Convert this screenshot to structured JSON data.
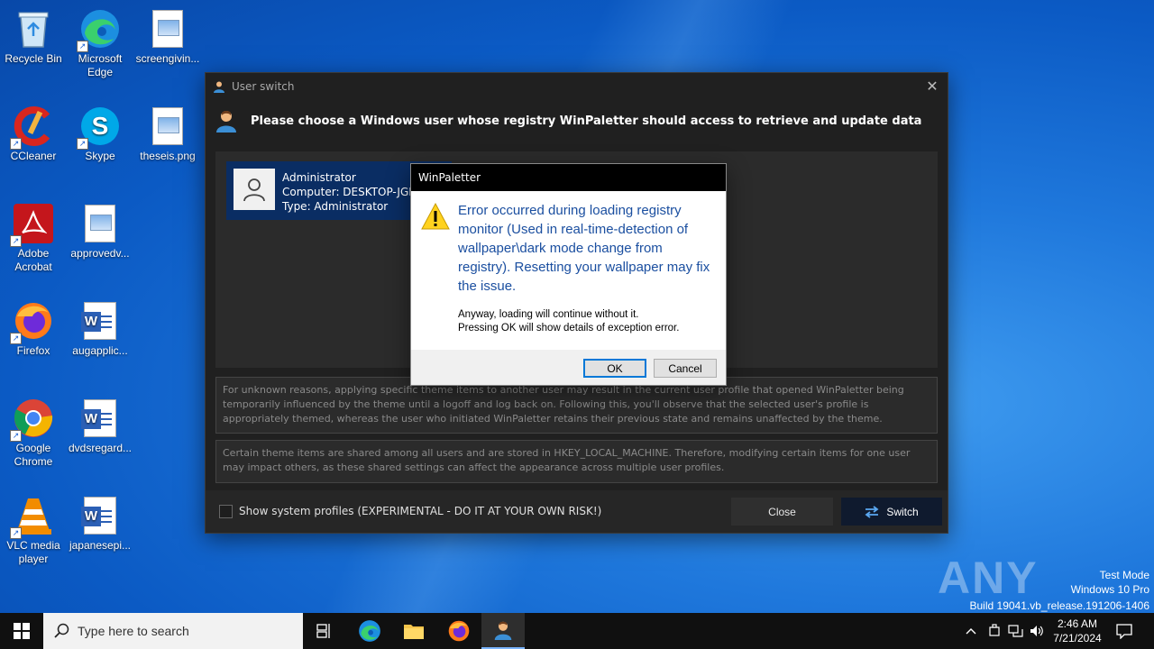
{
  "desktop": {
    "icons": [
      {
        "label": "Recycle Bin",
        "icon": "recycle-bin-icon"
      },
      {
        "label": "Microsoft Edge",
        "icon": "edge-icon"
      },
      {
        "label": "screengivin...",
        "icon": "image-file-icon"
      },
      {
        "label": "CCleaner",
        "icon": "ccleaner-icon"
      },
      {
        "label": "Skype",
        "icon": "skype-icon"
      },
      {
        "label": "theseis.png",
        "icon": "image-file-icon"
      },
      {
        "label": "Adobe Acrobat",
        "icon": "acrobat-icon"
      },
      {
        "label": "approvedv...",
        "icon": "image-file-icon"
      },
      {
        "label": "Firefox",
        "icon": "firefox-icon"
      },
      {
        "label": "augapplic...",
        "icon": "word-doc-icon"
      },
      {
        "label": "Google Chrome",
        "icon": "chrome-icon"
      },
      {
        "label": "dvdsregard...",
        "icon": "word-doc-icon"
      },
      {
        "label": "VLC media player",
        "icon": "vlc-icon"
      },
      {
        "label": "japanesepi...",
        "icon": "word-doc-icon"
      }
    ]
  },
  "window": {
    "title": "User switch",
    "header": "Please choose a Windows user whose registry WinPaletter should access to retrieve and update data",
    "user": {
      "name": "Administrator",
      "computer": "Computer:  DESKTOP-JGLL",
      "type": "Type: Administrator"
    },
    "note1": "For unknown reasons, applying specific theme items to another user may result in the current user profile that opened WinPaletter being temporarily influenced by the theme until a logoff and log back on. Following this, you'll observe that the selected user's profile is appropriately themed, whereas the user who initiated WinPaletter retains their previous state and remains unaffected by the theme.",
    "note2": "Certain theme items are shared among all users and are stored in HKEY_LOCAL_MACHINE. Therefore, modifying certain items for one user may impact others, as these shared settings can affect the appearance across multiple user profiles.",
    "checkbox_label": "Show system profiles (EXPERIMENTAL - DO IT AT YOUR OWN RISK!)",
    "close_label": "Close",
    "switch_label": "Switch"
  },
  "dialog": {
    "title": "WinPaletter",
    "message": "Error occurred during loading registry monitor (Used in real-time-detection of wallpaper\\dark mode change from registry). Resetting your wallpaper may fix the issue.",
    "detail_line1": "Anyway, loading will continue without it.",
    "detail_line2": "Pressing OK will show details of exception error.",
    "ok_label": "OK",
    "cancel_label": "Cancel"
  },
  "watermark": {
    "brand": "ANY RUN",
    "mode": "Test Mode",
    "os": "Windows 10 Pro",
    "build": "Build 19041.vb_release.191206-1406"
  },
  "taskbar": {
    "search_placeholder": "Type here to search",
    "time": "2:46 AM",
    "date": "7/21/2024"
  }
}
